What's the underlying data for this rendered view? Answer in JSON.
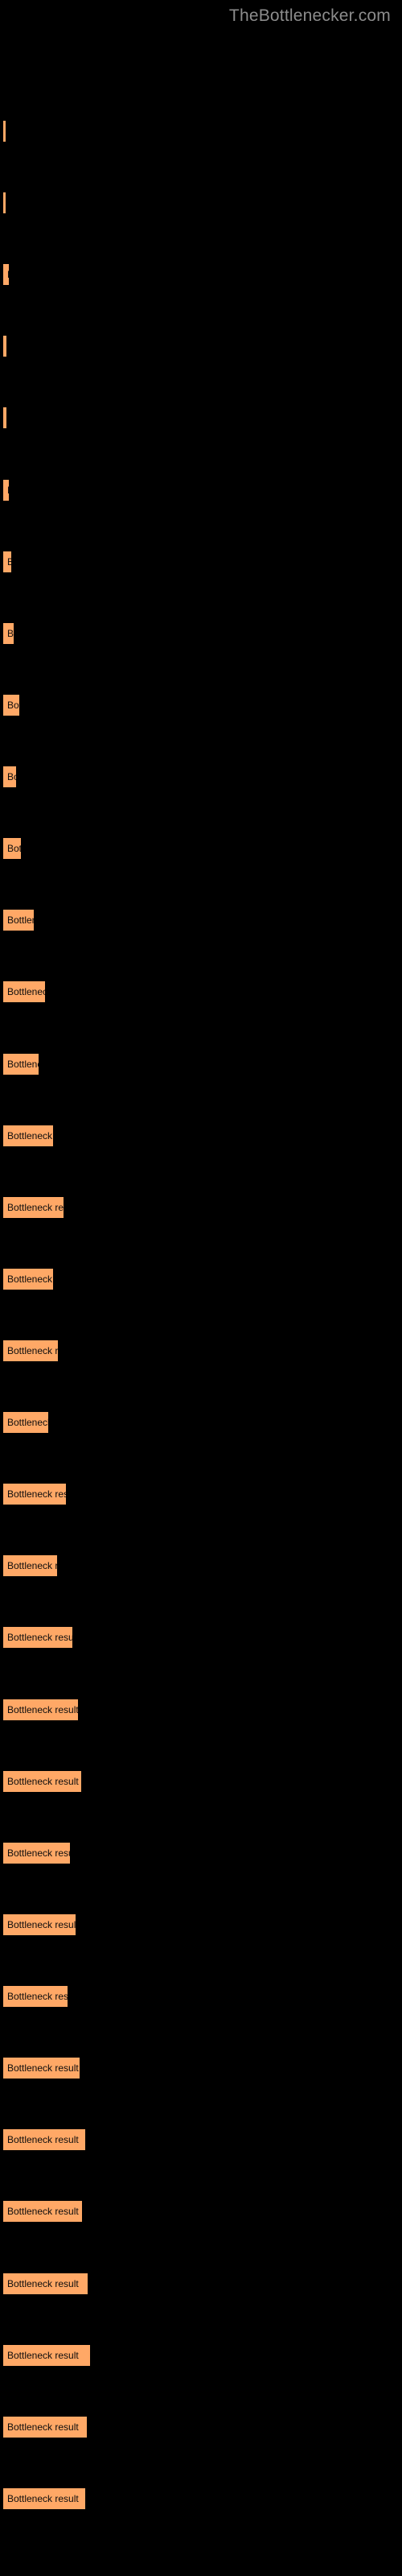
{
  "watermark": "TheBottlenecker.com",
  "chart_data": {
    "type": "bar",
    "title": "",
    "subtitle": "",
    "xlabel": "",
    "ylabel": "",
    "orientation": "horizontal",
    "grid": false,
    "legend": false,
    "bar_color": "#ffa866",
    "background_color": "#000000",
    "categories": [
      "",
      "",
      "",
      "",
      "",
      "",
      "",
      "",
      "",
      "",
      "",
      "",
      "",
      "",
      "",
      "",
      "",
      "",
      "",
      "",
      "",
      "",
      "",
      "",
      "",
      "",
      "",
      "",
      "",
      "",
      "",
      "",
      "",
      ""
    ],
    "bar_label_text": "Bottleneck result",
    "values": [
      3,
      3,
      7,
      4,
      4,
      7,
      10,
      13,
      20,
      16,
      22,
      38,
      52,
      44,
      62,
      75,
      62,
      68,
      56,
      78,
      67,
      86,
      93,
      97,
      83,
      90,
      80,
      95,
      102,
      98,
      105,
      108,
      104,
      102
    ],
    "ylim": [
      0,
      110
    ],
    "bars": [
      {
        "label": "",
        "value": 3,
        "width": 3
      },
      {
        "label": "",
        "value": 3,
        "width": 3
      },
      {
        "label": "",
        "value": 7,
        "width": 7
      },
      {
        "label": "",
        "value": 4,
        "width": 4
      },
      {
        "label": "",
        "value": 4,
        "width": 4
      },
      {
        "label": "",
        "value": 7,
        "width": 7
      },
      {
        "label": "B",
        "value": 10,
        "width": 10
      },
      {
        "label": "Bo",
        "value": 13,
        "width": 13
      },
      {
        "label": "Bot",
        "value": 20,
        "width": 20
      },
      {
        "label": "Bo",
        "value": 16,
        "width": 16
      },
      {
        "label": "Bott",
        "value": 22,
        "width": 22
      },
      {
        "label": "Bottlene",
        "value": 38,
        "width": 38
      },
      {
        "label": "Bottleneck re",
        "value": 52,
        "width": 52
      },
      {
        "label": "Bottleneck",
        "value": 44,
        "width": 44
      },
      {
        "label": "Bottleneck res",
        "value": 62,
        "width": 62
      },
      {
        "label": "Bottleneck result",
        "value": 75,
        "width": 75
      },
      {
        "label": "Bottleneck res",
        "value": 62,
        "width": 62
      },
      {
        "label": "Bottleneck resu",
        "value": 68,
        "width": 68
      },
      {
        "label": "Bottleneck r",
        "value": 56,
        "width": 56
      },
      {
        "label": "Bottleneck result",
        "value": 78,
        "width": 78
      },
      {
        "label": "Bottleneck resu",
        "value": 67,
        "width": 67
      },
      {
        "label": "Bottleneck result",
        "value": 86,
        "width": 86
      },
      {
        "label": "Bottleneck result",
        "value": 93,
        "width": 93
      },
      {
        "label": "Bottleneck result",
        "value": 97,
        "width": 97
      },
      {
        "label": "Bottleneck result",
        "value": 83,
        "width": 83
      },
      {
        "label": "Bottleneck result",
        "value": 90,
        "width": 90
      },
      {
        "label": "Bottleneck result",
        "value": 80,
        "width": 80
      },
      {
        "label": "Bottleneck result",
        "value": 95,
        "width": 95
      },
      {
        "label": "Bottleneck result",
        "value": 102,
        "width": 102
      },
      {
        "label": "Bottleneck result",
        "value": 98,
        "width": 98
      },
      {
        "label": "Bottleneck result",
        "value": 105,
        "width": 105
      },
      {
        "label": "Bottleneck result",
        "value": 108,
        "width": 108
      },
      {
        "label": "Bottleneck result",
        "value": 104,
        "width": 104
      },
      {
        "label": "Bottleneck result",
        "value": 102,
        "width": 102
      }
    ]
  }
}
